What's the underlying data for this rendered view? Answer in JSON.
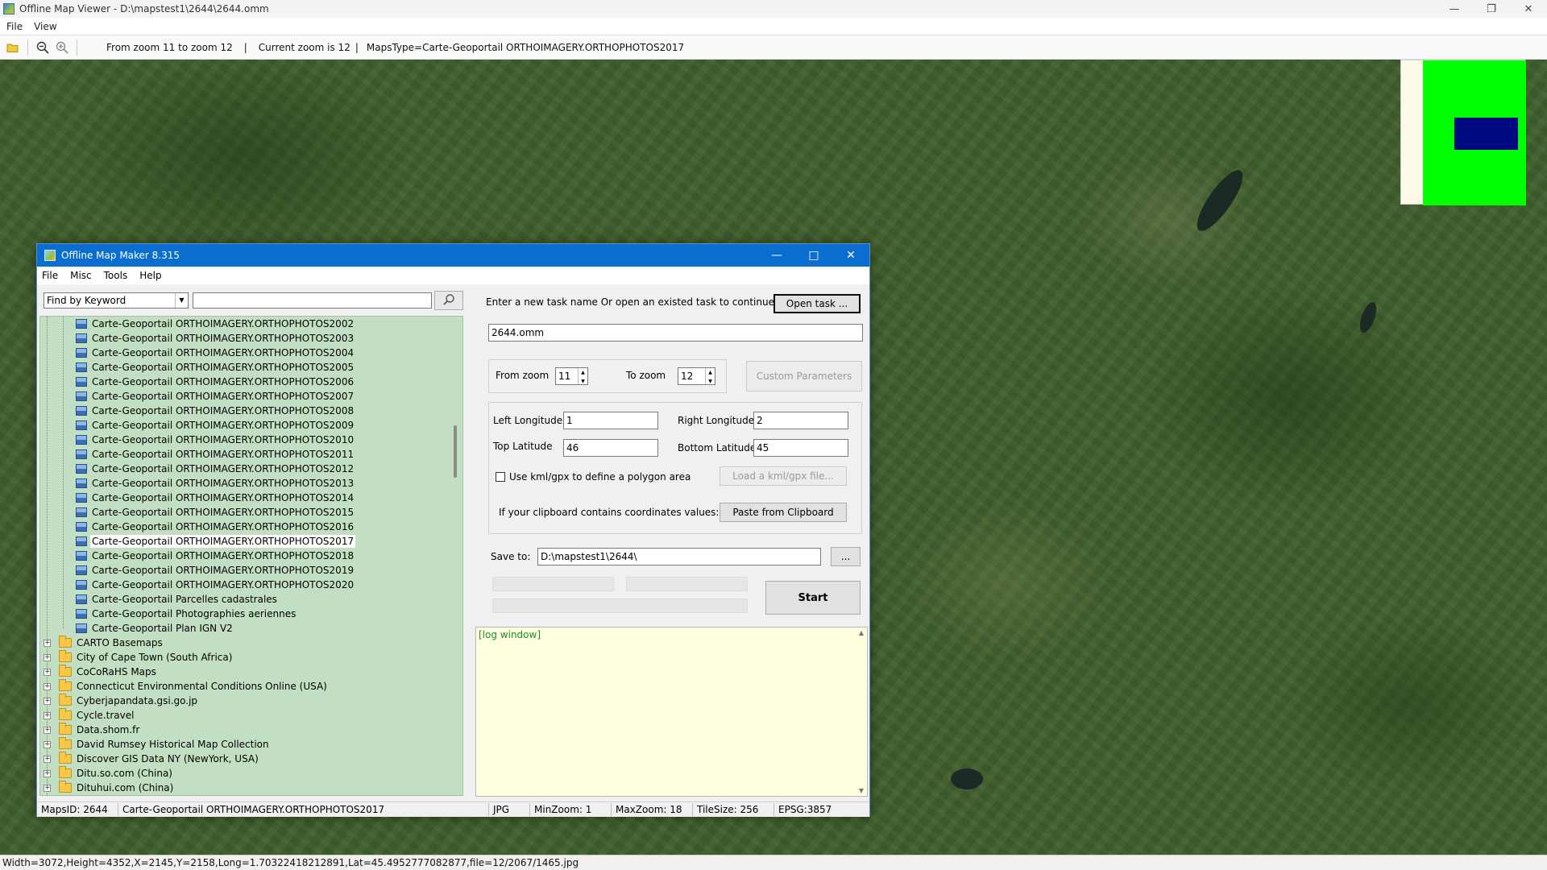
{
  "viewer": {
    "title": "Offline Map Viewer - D:\\mapstest1\\2644\\2644.omm",
    "menu": [
      "File",
      "View"
    ],
    "toolbar": {
      "zoom_range": "From zoom 11 to zoom 12",
      "current_zoom": "Current zoom is 12",
      "maps_type": "MapsType=Carte-Geoportail ORTHOIMAGERY.ORTHOPHOTOS2017"
    },
    "status_line": "Width=3072,Height=4352,X=2145,Y=2158,Long=1.70322418212891,Lat=45.4952777082877,file=12/2067/1465.jpg"
  },
  "dialog": {
    "title": "Offline Map Maker 8.315",
    "menu": [
      "File",
      "Misc",
      "Tools",
      "Help"
    ],
    "find_by": "Find by Keyword",
    "keyword": "",
    "tree": {
      "children": [
        "Carte-Geoportail ORTHOIMAGERY.ORTHOPHOTOS2002",
        "Carte-Geoportail ORTHOIMAGERY.ORTHOPHOTOS2003",
        "Carte-Geoportail ORTHOIMAGERY.ORTHOPHOTOS2004",
        "Carte-Geoportail ORTHOIMAGERY.ORTHOPHOTOS2005",
        "Carte-Geoportail ORTHOIMAGERY.ORTHOPHOTOS2006",
        "Carte-Geoportail ORTHOIMAGERY.ORTHOPHOTOS2007",
        "Carte-Geoportail ORTHOIMAGERY.ORTHOPHOTOS2008",
        "Carte-Geoportail ORTHOIMAGERY.ORTHOPHOTOS2009",
        "Carte-Geoportail ORTHOIMAGERY.ORTHOPHOTOS2010",
        "Carte-Geoportail ORTHOIMAGERY.ORTHOPHOTOS2011",
        "Carte-Geoportail ORTHOIMAGERY.ORTHOPHOTOS2012",
        "Carte-Geoportail ORTHOIMAGERY.ORTHOPHOTOS2013",
        "Carte-Geoportail ORTHOIMAGERY.ORTHOPHOTOS2014",
        "Carte-Geoportail ORTHOIMAGERY.ORTHOPHOTOS2015",
        "Carte-Geoportail ORTHOIMAGERY.ORTHOPHOTOS2016",
        "Carte-Geoportail ORTHOIMAGERY.ORTHOPHOTOS2017",
        "Carte-Geoportail ORTHOIMAGERY.ORTHOPHOTOS2018",
        "Carte-Geoportail ORTHOIMAGERY.ORTHOPHOTOS2019",
        "Carte-Geoportail ORTHOIMAGERY.ORTHOPHOTOS2020",
        "Carte-Geoportail Parcelles cadastrales",
        "Carte-Geoportail Photographies aeriennes",
        "Carte-Geoportail Plan IGN V2"
      ],
      "selected_index": 15,
      "folders": [
        "CARTO Basemaps",
        "City of Cape Town (South Africa)",
        "CoCoRaHS Maps",
        "Connecticut Environmental Conditions Online (USA)",
        "Cyberjapandata.gsi.go.jp",
        "Cycle.travel",
        "Data.shom.fr",
        "David Rumsey Historical Map Collection",
        "Discover GIS Data NY (NewYork, USA)",
        "Ditu.so.com (China)",
        "Dituhui.com (China)"
      ]
    },
    "task_prompt": "Enter a new task name Or open an existed task to continue:",
    "open_task_label": "Open task ...",
    "task_name": "2644.omm",
    "from_zoom_label": "From zoom",
    "from_zoom": "11",
    "to_zoom_label": "To zoom",
    "to_zoom": "12",
    "custom_params_label": "Custom Parameters",
    "left_lon_label": "Left Longitude",
    "left_lon": "1",
    "right_lon_label": "Right Longitude",
    "right_lon": "2",
    "top_lat_label": "Top Latitude",
    "top_lat": "46",
    "bottom_lat_label": "Bottom Latitude",
    "bottom_lat": "45",
    "kml_checkbox_label": "Use kml/gpx to define a polygon area",
    "kml_checked": false,
    "load_kml_label": "Load a kml/gpx file...",
    "clipboard_prompt": "If your clipboard contains coordinates values:",
    "paste_label": "Paste from Clipboard",
    "save_to_label": "Save to:",
    "save_to": "D:\\mapstest1\\2644\\",
    "browse_label": "...",
    "start_label": "Start",
    "log_text": "[log window]",
    "status": {
      "maps_id": "MapsID: 2644",
      "map_name": "Carte-Geoportail ORTHOIMAGERY.ORTHOPHOTOS2017",
      "format": "JPG",
      "min_zoom": "MinZoom: 1",
      "max_zoom": "MaxZoom: 18",
      "tile_size": "TileSize: 256",
      "epsg": "EPSG:3857"
    }
  },
  "colors": {
    "dialog_title_bg": "#0a6ed1",
    "tree_bg": "#c3dfc3",
    "log_bg": "#ffffe0",
    "overview_green": "#00ff00",
    "overview_blue": "#000a80"
  }
}
